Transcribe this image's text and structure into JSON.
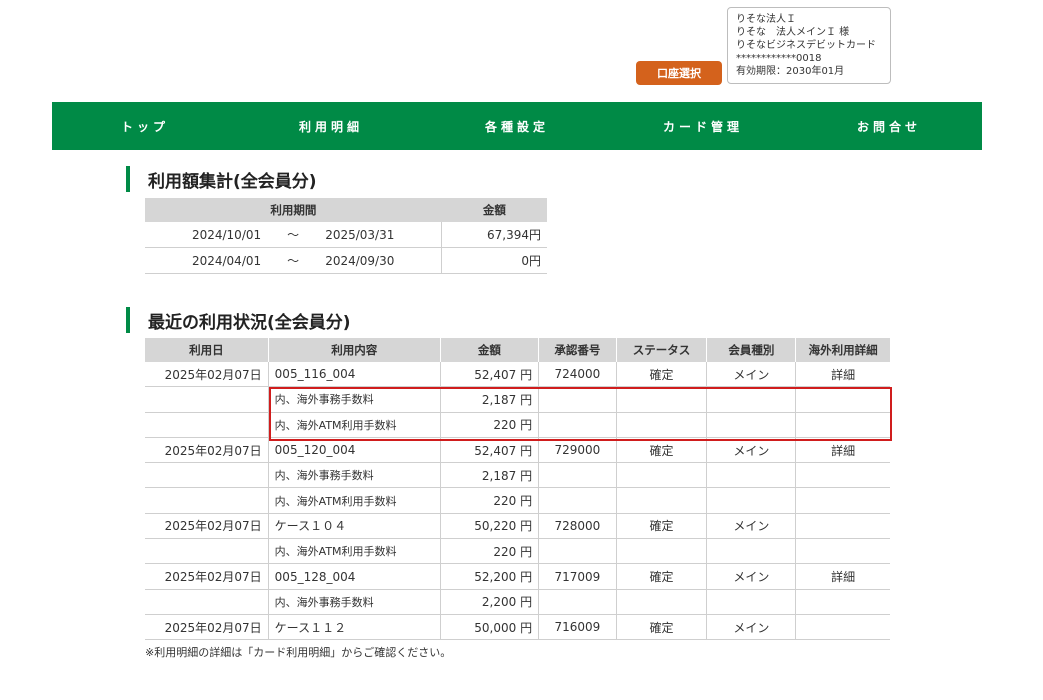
{
  "account": {
    "lines": [
      "りそな法人Ｉ",
      "りそな　法人メインＩ 様",
      "りそなビジネスデビットカード",
      "************0018",
      "有効期限：2030年01月"
    ],
    "select_button": "口座選択"
  },
  "nav": [
    "トップ",
    "利用明細",
    "各種設定",
    "カード管理",
    "お問合せ"
  ],
  "summary": {
    "title": "利用額集計(全会員分)",
    "headers": [
      "利用期間",
      "金額"
    ],
    "rows": [
      {
        "from": "2024/10/01",
        "sep": "～",
        "to": "2025/03/31",
        "amount": "67,394円"
      },
      {
        "from": "2024/04/01",
        "sep": "～",
        "to": "2024/09/30",
        "amount": "0円"
      }
    ]
  },
  "recent": {
    "title": "最近の利用状況(全会員分)",
    "headers": [
      "利用日",
      "利用内容",
      "金額",
      "承認番号",
      "ステータス",
      "会員種別",
      "海外利用詳細"
    ],
    "rows": [
      {
        "date": "2025年02月07日",
        "desc": "005_116_004",
        "amount": "52,407 円",
        "approval": "724000",
        "status": "確定",
        "kind": "メイン",
        "detail": "詳細",
        "sub": false
      },
      {
        "date": "",
        "desc": "内、海外事務手数料",
        "amount": "2,187 円",
        "approval": "",
        "status": "",
        "kind": "",
        "detail": "",
        "sub": true
      },
      {
        "date": "",
        "desc": "内、海外ATM利用手数料",
        "amount": "220 円",
        "approval": "",
        "status": "",
        "kind": "",
        "detail": "",
        "sub": true
      },
      {
        "date": "2025年02月07日",
        "desc": "005_120_004",
        "amount": "52,407 円",
        "approval": "729000",
        "status": "確定",
        "kind": "メイン",
        "detail": "詳細",
        "sub": false
      },
      {
        "date": "",
        "desc": "内、海外事務手数料",
        "amount": "2,187 円",
        "approval": "",
        "status": "",
        "kind": "",
        "detail": "",
        "sub": true
      },
      {
        "date": "",
        "desc": "内、海外ATM利用手数料",
        "amount": "220 円",
        "approval": "",
        "status": "",
        "kind": "",
        "detail": "",
        "sub": true
      },
      {
        "date": "2025年02月07日",
        "desc": "ケース１０４",
        "amount": "50,220 円",
        "approval": "728000",
        "status": "確定",
        "kind": "メイン",
        "detail": "",
        "sub": false
      },
      {
        "date": "",
        "desc": "内、海外ATM利用手数料",
        "amount": "220 円",
        "approval": "",
        "status": "",
        "kind": "",
        "detail": "",
        "sub": true
      },
      {
        "date": "2025年02月07日",
        "desc": "005_128_004",
        "amount": "52,200 円",
        "approval": "717009",
        "status": "確定",
        "kind": "メイン",
        "detail": "詳細",
        "sub": false
      },
      {
        "date": "",
        "desc": "内、海外事務手数料",
        "amount": "2,200 円",
        "approval": "",
        "status": "",
        "kind": "",
        "detail": "",
        "sub": true
      },
      {
        "date": "2025年02月07日",
        "desc": "ケース１１２",
        "amount": "50,000 円",
        "approval": "716009",
        "status": "確定",
        "kind": "メイン",
        "detail": "",
        "sub": false
      }
    ]
  },
  "note": "※利用明細の詳細は「カード利用明細」からご確認ください。",
  "colors": {
    "nav": "#008a46",
    "button": "#d4621c",
    "highlight": "#d01d1d"
  }
}
